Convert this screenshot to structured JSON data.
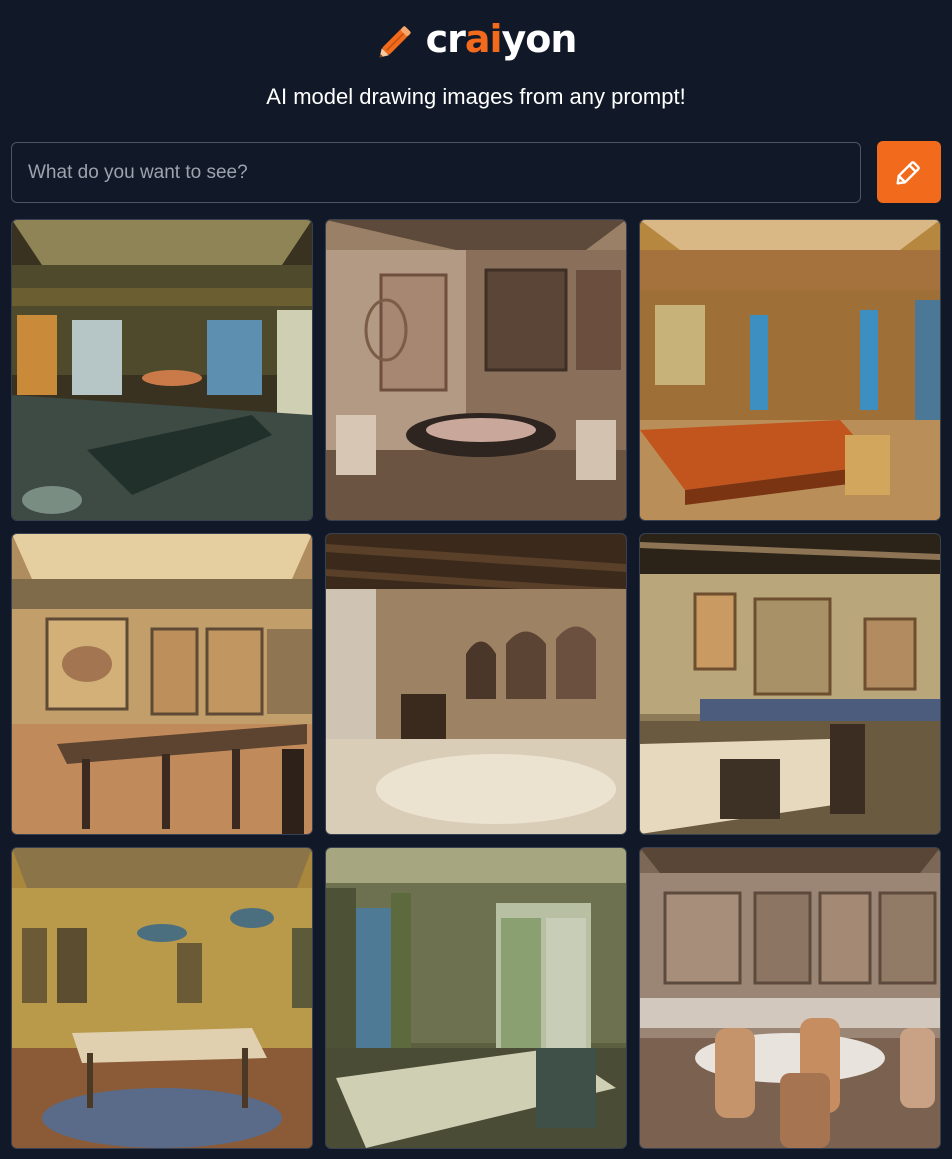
{
  "header": {
    "logo_text_start": "cr",
    "logo_text_accent": "ai",
    "logo_text_end": "yon",
    "tagline": "AI model drawing images from any prompt!"
  },
  "search": {
    "placeholder": "What do you want to see?",
    "value": ""
  },
  "draw_button": {
    "icon": "pencil-icon"
  },
  "colors": {
    "background": "#111827",
    "accent": "#f26b1d",
    "input_border": "#4b5563"
  },
  "results": {
    "count": 9,
    "images": [
      {
        "id": 1,
        "scene": "dim dining hall with long table, windows to sea"
      },
      {
        "id": 2,
        "scene": "ornate patterned room with round table"
      },
      {
        "id": 3,
        "scene": "warm orange room with wooden table"
      },
      {
        "id": 4,
        "scene": "patterned hall with long dark table"
      },
      {
        "id": 5,
        "scene": "beamed ceiling room with arches"
      },
      {
        "id": 6,
        "scene": "framed panels with white-cloth table"
      },
      {
        "id": 7,
        "scene": "gold hall with chairs around table"
      },
      {
        "id": 8,
        "scene": "green room with large windows"
      },
      {
        "id": 9,
        "scene": "tapestry walls with chairs"
      }
    ]
  }
}
